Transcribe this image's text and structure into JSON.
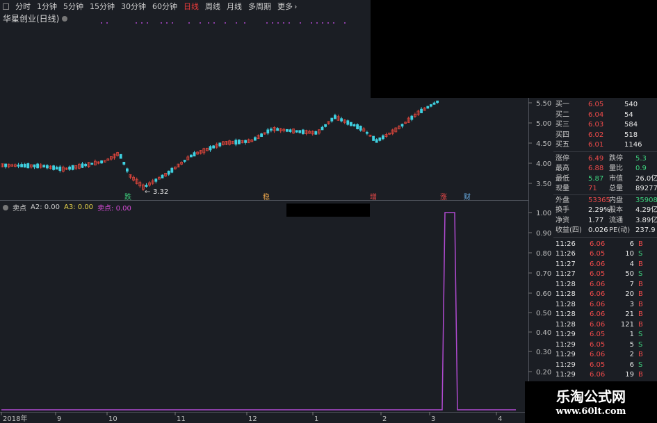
{
  "toolbar": {
    "items": [
      "分时",
      "1分钟",
      "5分钟",
      "15分钟",
      "30分钟",
      "60分钟",
      "日线",
      "周线",
      "月线",
      "多周期",
      "更多"
    ],
    "active_index": 6,
    "more_arrow": "›"
  },
  "stock": {
    "name": "华星创业(日线)"
  },
  "price_axis": {
    "ticks": [
      "5.50",
      "5.00",
      "4.50",
      "4.00",
      "3.50"
    ]
  },
  "low_label": "3.32",
  "event_markers": [
    {
      "label": "跌",
      "color": "#3ed27e"
    },
    {
      "label": "稳",
      "color": "#e6a24a"
    },
    {
      "label": "增",
      "color": "#f04a4a"
    },
    {
      "label": "涨",
      "color": "#f04a4a"
    },
    {
      "label": "财",
      "color": "#6aaee6"
    }
  ],
  "indicator": {
    "name": "卖点",
    "a2": "A2: 0.00",
    "a3": "A3: 0.00",
    "sell": "卖点: 0.00",
    "axis_ticks": [
      "1.00",
      "0.90",
      "0.80",
      "0.70",
      "0.60",
      "0.50",
      "0.40",
      "0.30",
      "0.20"
    ]
  },
  "date_axis": [
    "2018年",
    "9",
    "10",
    "11",
    "12",
    "1",
    "2",
    "3",
    "4"
  ],
  "order_book": [
    {
      "label": "买一",
      "price": "6.05",
      "vol": "540"
    },
    {
      "label": "买二",
      "price": "6.04",
      "vol": "54"
    },
    {
      "label": "买三",
      "price": "6.03",
      "vol": "584"
    },
    {
      "label": "买四",
      "price": "6.02",
      "vol": "518"
    },
    {
      "label": "买五",
      "price": "6.01",
      "vol": "1146"
    }
  ],
  "stats": [
    {
      "l1": "涨停",
      "v1": "6.49",
      "c1": "red",
      "l2": "跌停",
      "v2": "5.3",
      "c2": "green"
    },
    {
      "l1": "最高",
      "v1": "6.88",
      "c1": "red",
      "l2": "量比",
      "v2": "0.9",
      "c2": "green"
    },
    {
      "l1": "最低",
      "v1": "5.87",
      "c1": "green",
      "l2": "市值",
      "v2": "26.0亿",
      "c2": "white"
    },
    {
      "l1": "现量",
      "v1": "71",
      "c1": "red",
      "l2": "总量",
      "v2": "89277",
      "c2": "white"
    },
    {
      "l1": "外盘",
      "v1": "53365",
      "c1": "red",
      "l2": "内盘",
      "v2": "35908",
      "c2": "green"
    },
    {
      "l1": "换手",
      "v1": "2.29%",
      "c1": "white",
      "l2": "股本",
      "v2": "4.29亿",
      "c2": "white"
    },
    {
      "l1": "净资",
      "v1": "1.77",
      "c1": "white",
      "l2": "流通",
      "v2": "3.89亿",
      "c2": "white"
    },
    {
      "l1": "收益(四)",
      "v1": "0.026",
      "c1": "white",
      "l2": "PE(动)",
      "v2": "237.9",
      "c2": "white"
    }
  ],
  "ticks": [
    {
      "time": "11:26",
      "price": "6.06",
      "vol": "6",
      "side": "B"
    },
    {
      "time": "11:26",
      "price": "6.05",
      "vol": "10",
      "side": "S"
    },
    {
      "time": "11:27",
      "price": "6.06",
      "vol": "4",
      "side": "B"
    },
    {
      "time": "11:27",
      "price": "6.05",
      "vol": "50",
      "side": "S"
    },
    {
      "time": "11:28",
      "price": "6.06",
      "vol": "7",
      "side": "B"
    },
    {
      "time": "11:28",
      "price": "6.06",
      "vol": "20",
      "side": "B"
    },
    {
      "time": "11:28",
      "price": "6.06",
      "vol": "3",
      "side": "B"
    },
    {
      "time": "11:28",
      "price": "6.06",
      "vol": "21",
      "side": "B"
    },
    {
      "time": "11:28",
      "price": "6.06",
      "vol": "121",
      "side": "B"
    },
    {
      "time": "11:29",
      "price": "6.05",
      "vol": "1",
      "side": "S"
    },
    {
      "time": "11:29",
      "price": "6.05",
      "vol": "5",
      "side": "S"
    },
    {
      "time": "11:29",
      "price": "6.06",
      "vol": "2",
      "side": "B"
    },
    {
      "time": "11:29",
      "price": "6.05",
      "vol": "6",
      "side": "S"
    },
    {
      "time": "11:29",
      "price": "6.06",
      "vol": "19",
      "side": "B"
    }
  ],
  "watermark": {
    "title": "乐淘公式网",
    "url": "www.60lt.com"
  },
  "colors": {
    "up": "#e0463c",
    "down": "#3fd0e0",
    "indicator": "#b04ad0",
    "background": "#1b1e24"
  }
}
